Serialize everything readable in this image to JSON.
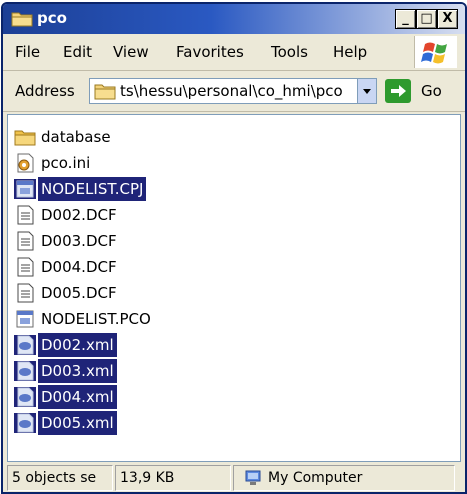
{
  "window": {
    "title": "pco",
    "controls": [
      "_",
      "□",
      "X"
    ]
  },
  "menu": {
    "items": [
      "File",
      "Edit",
      "View",
      "Favorites",
      "Tools",
      "Help"
    ]
  },
  "address": {
    "label": "Address",
    "path": "ts\\hessu\\personal\\co_hmi\\pco",
    "go_label": "Go"
  },
  "files": [
    {
      "name": "database",
      "icon": "folder-icon",
      "selected": false
    },
    {
      "name": "pco.ini",
      "icon": "settings-file-icon",
      "selected": false
    },
    {
      "name": "NODELIST.CPJ",
      "icon": "app-file-icon",
      "selected": true
    },
    {
      "name": "D002.DCF",
      "icon": "text-file-icon",
      "selected": false
    },
    {
      "name": "D003.DCF",
      "icon": "text-file-icon",
      "selected": false
    },
    {
      "name": "D004.DCF",
      "icon": "text-file-icon",
      "selected": false
    },
    {
      "name": "D005.DCF",
      "icon": "text-file-icon",
      "selected": false
    },
    {
      "name": "NODELIST.PCO",
      "icon": "app-file-icon",
      "selected": false
    },
    {
      "name": "D002.xml",
      "icon": "xml-file-icon",
      "selected": true
    },
    {
      "name": "D003.xml",
      "icon": "xml-file-icon",
      "selected": true
    },
    {
      "name": "D004.xml",
      "icon": "xml-file-icon",
      "selected": true
    },
    {
      "name": "D005.xml",
      "icon": "xml-file-icon",
      "selected": true
    }
  ],
  "status": {
    "objects": "5 objects se",
    "size": "13,9 KB",
    "location": "My Computer"
  },
  "colors": {
    "title_bar": "#2a59c2",
    "selection": "#1f2478",
    "folder": "#f0c24a",
    "go_button": "#2e9a2e"
  }
}
